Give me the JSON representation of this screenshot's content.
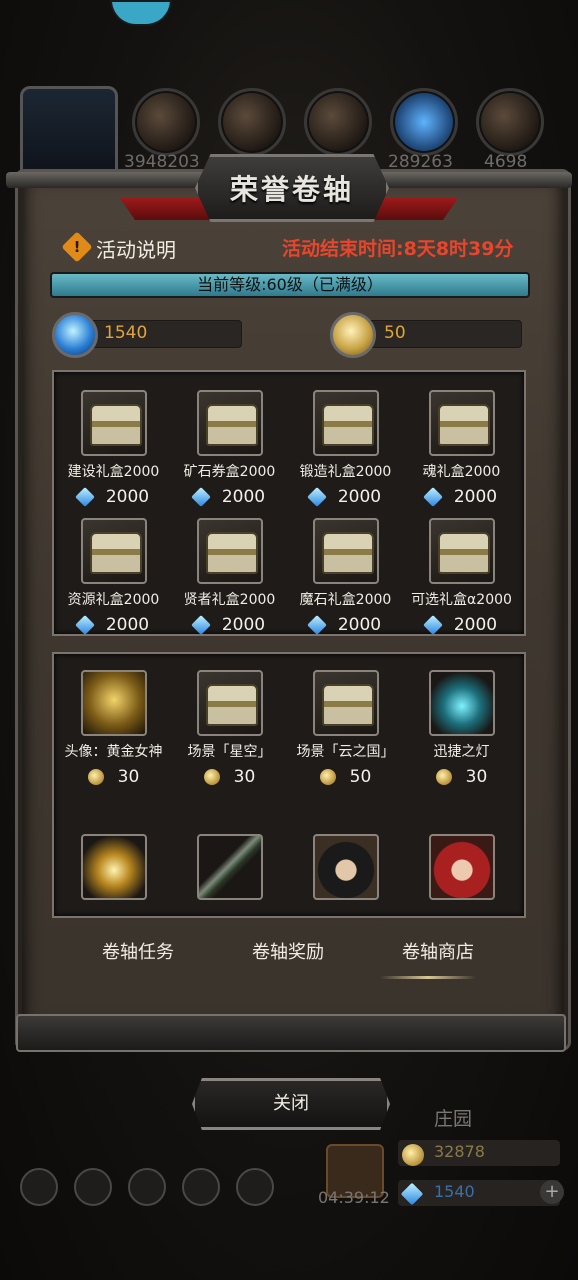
{
  "background": {
    "resource_numbers": [
      "3948203",
      "289263",
      "4698"
    ],
    "side_label": "庄园",
    "gold_value": "32878",
    "gem_value": "1540",
    "countdown": "04:39:12",
    "plus_label": "+"
  },
  "panel": {
    "title": "荣誉卷轴",
    "info_label": "活动说明",
    "info_icon_glyph": "!",
    "end_time": "活动结束时间:8天8时39分",
    "level_text": "当前等级:60级（已满级）",
    "gems": "1540",
    "coins": "50"
  },
  "gem_shop": [
    {
      "name": "建设礼盒2000",
      "price": "2000"
    },
    {
      "name": "矿石券盒2000",
      "price": "2000"
    },
    {
      "name": "锻造礼盒2000",
      "price": "2000"
    },
    {
      "name": "魂礼盒2000",
      "price": "2000"
    },
    {
      "name": "资源礼盒2000",
      "price": "2000"
    },
    {
      "name": "贤者礼盒2000",
      "price": "2000"
    },
    {
      "name": "魔石礼盒2000",
      "price": "2000"
    },
    {
      "name": "可选礼盒α2000",
      "price": "2000"
    }
  ],
  "coin_shop": [
    {
      "name": "头像：黄金女神",
      "price": "30",
      "icon": "golden-goddess-icon"
    },
    {
      "name": "场景「星空」",
      "price": "30",
      "icon": "chest-icon"
    },
    {
      "name": "场景「云之国」",
      "price": "50",
      "icon": "chest-icon"
    },
    {
      "name": "迅捷之灯",
      "price": "30",
      "icon": "swift-lamp-icon"
    },
    {
      "icon": "lantern-icon"
    },
    {
      "icon": "spear-icon"
    },
    {
      "icon": "nun-portrait-icon"
    },
    {
      "icon": "redhead-portrait-icon"
    }
  ],
  "tabs": [
    "卷轴任务",
    "卷轴奖励",
    "卷轴商店"
  ],
  "close_label": "关闭"
}
